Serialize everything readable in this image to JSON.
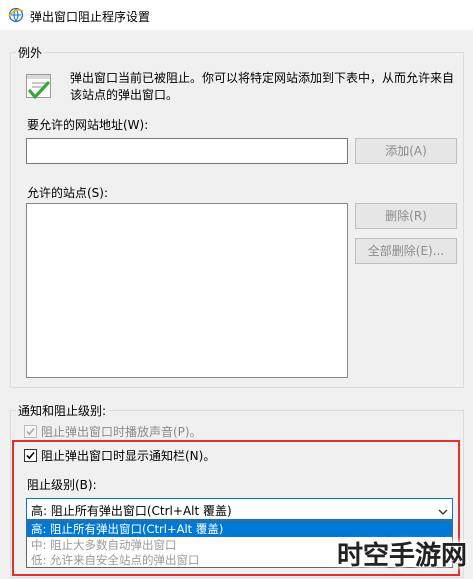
{
  "window": {
    "title": "弹出窗口阻止程序设置"
  },
  "exceptions": {
    "legend": "例外",
    "description_line1": "弹出窗口当前已被阻止。你可以将特定网站添加到下表中，从而允许来自",
    "description_line2": "该站点的弹出窗口。",
    "address_label": "要允许的网站地址(W):",
    "address_value": "",
    "add_button": "添加(A)",
    "allowed_label": "允许的站点(S):",
    "allowed_sites": [],
    "remove_button": "删除(R)",
    "remove_all_button": "全部删除(E)..."
  },
  "notifications": {
    "legend": "通知和阻止级别:",
    "play_sound": {
      "label": "阻止弹出窗口时播放声音(P)。",
      "checked": true,
      "enabled": false
    },
    "show_bar": {
      "label": "阻止弹出窗口时显示通知栏(N)。",
      "checked": true,
      "enabled": true
    },
    "blocking_level_label": "阻止级别(B):",
    "blocking_level_value": "高: 阻止所有弹出窗口(Ctrl+Alt 覆盖)",
    "options": [
      "高: 阻止所有弹出窗口(Ctrl+Alt 覆盖)",
      "中: 阻止大多数自动弹出窗口",
      "低: 允许来自安全站点的弹出窗口"
    ]
  },
  "watermark": {
    "text": "时空手游网"
  },
  "colors": {
    "highlight": "#e0312c",
    "accent": "#0078d7"
  }
}
